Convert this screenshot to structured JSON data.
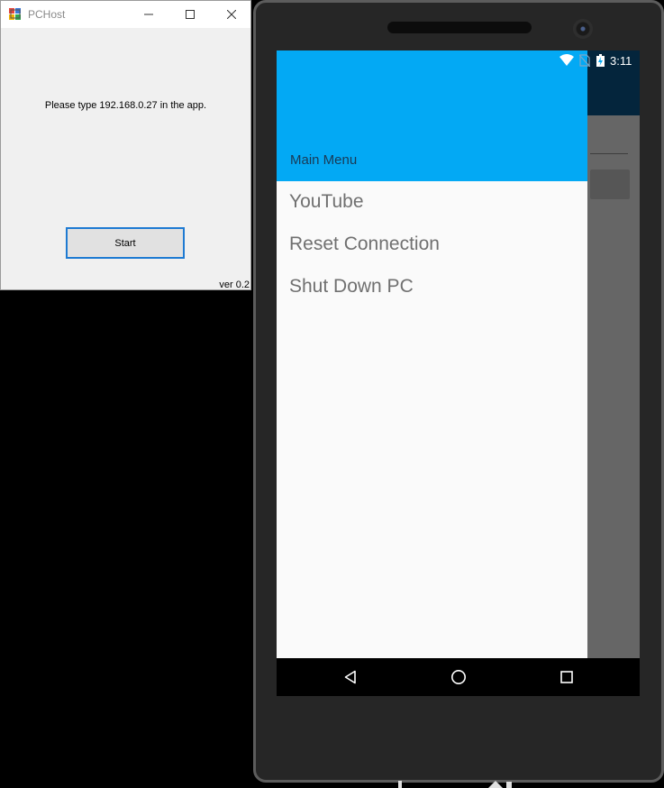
{
  "host_window": {
    "title": "PCHost",
    "message": "Please type 192.168.0.27 in the app.",
    "start_label": "Start",
    "version": "ver 0.2",
    "controls": {
      "minimize_icon": "minimize-icon",
      "maximize_icon": "maximize-icon",
      "close_icon": "close-icon"
    }
  },
  "phone": {
    "status_bar": {
      "time": "3:11",
      "icons": [
        "wifi-icon",
        "no-sim-icon",
        "battery-charging-icon"
      ]
    },
    "drawer": {
      "header_title": "Main Menu",
      "header_color": "#03a9f4",
      "items": [
        {
          "label": "YouTube"
        },
        {
          "label": "Reset Connection"
        },
        {
          "label": "Shut Down PC"
        }
      ]
    },
    "app_toolbar_color": "#0a5d96",
    "nav_bar": {
      "icons": [
        "back-icon",
        "home-icon",
        "recents-icon"
      ]
    }
  }
}
